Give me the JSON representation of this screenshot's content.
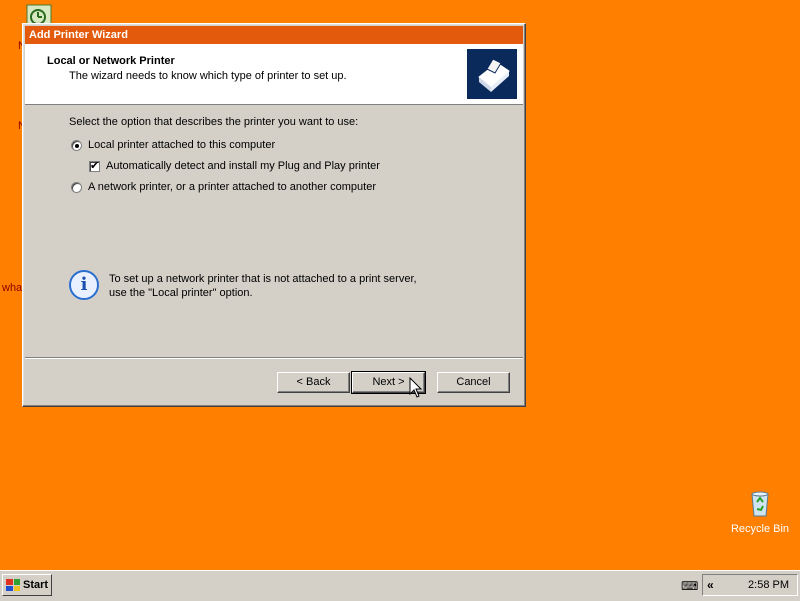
{
  "desktop": {
    "fragments": [
      "N",
      "N",
      "wha"
    ],
    "recycle_bin_label": "Recycle Bin"
  },
  "dialog": {
    "title": "Add Printer Wizard",
    "header_title": "Local or Network Printer",
    "header_subtitle": "The wizard needs to know which type of printer to set up.",
    "prompt": "Select the option that describes the printer you want to use:",
    "options": {
      "local_printer": "Local printer attached to this computer",
      "auto_detect": "Automatically detect and install my Plug and Play printer",
      "network_printer": "A network printer, or a printer attached to another computer"
    },
    "info_line1": "To set up a network printer that is not attached to a print server,",
    "info_line2": "use the \"Local printer\" option.",
    "buttons": {
      "back": "< Back",
      "next": "Next >",
      "cancel": "Cancel"
    }
  },
  "taskbar": {
    "start_label": "Start",
    "chevron": "«",
    "clock": "2:58 PM"
  },
  "colors": {
    "desktop": "#ff7f00",
    "titlebar": "#e45a0c",
    "dialog_face": "#d4d0c8"
  }
}
